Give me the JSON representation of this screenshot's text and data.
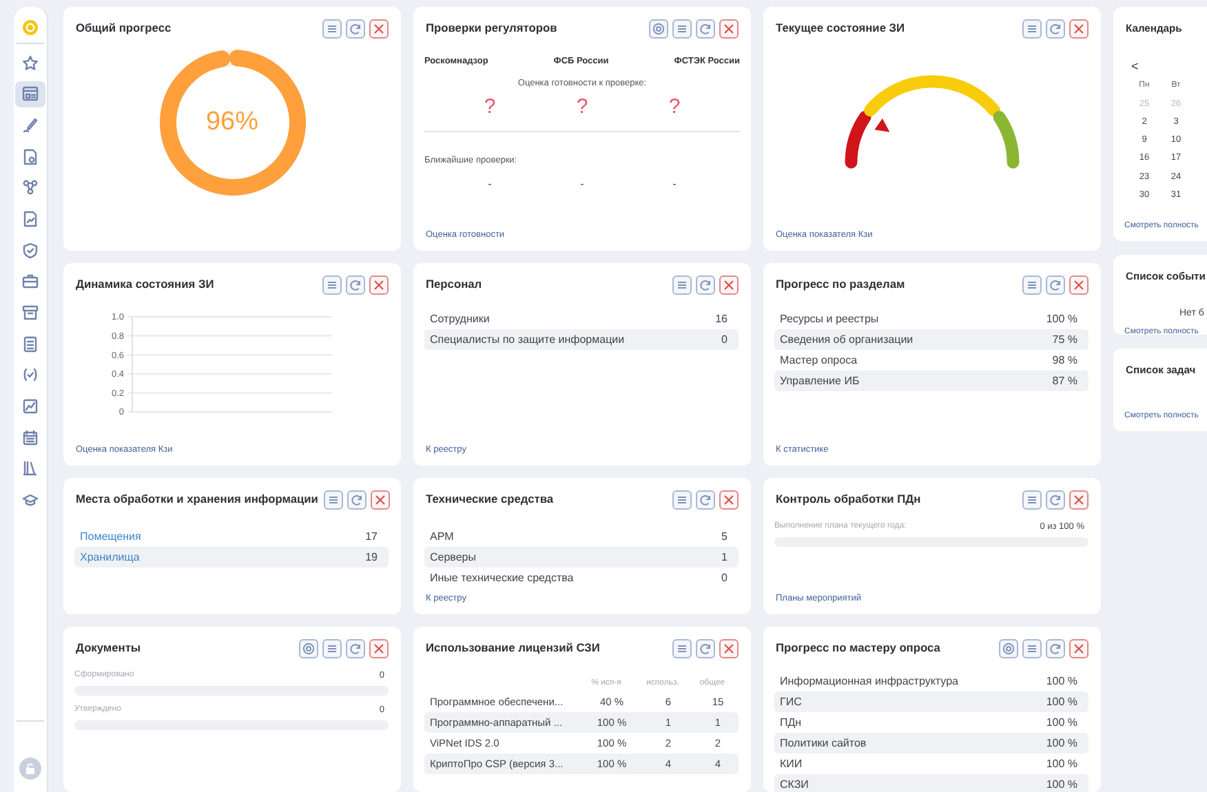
{
  "sidebar": {
    "items": [
      {
        "selected": false
      },
      {
        "selected": true
      },
      {
        "selected": false
      },
      {
        "selected": false
      },
      {
        "selected": false
      },
      {
        "selected": false
      },
      {
        "selected": false
      },
      {
        "selected": false
      },
      {
        "selected": false
      },
      {
        "selected": false
      },
      {
        "selected": false
      },
      {
        "selected": false
      },
      {
        "selected": false
      },
      {
        "selected": false
      },
      {
        "selected": false
      }
    ]
  },
  "cards": [
    {
      "kind": "donut",
      "title": "Общий прогресс",
      "actions": [
        {
          "kind": "menu"
        },
        {
          "kind": "refresh"
        },
        {
          "kind": "close"
        }
      ],
      "value": "96%",
      "level": 0.96
    },
    {
      "kind": "regulators",
      "title": "Проверки регуляторов",
      "actions": [
        {
          "kind": "settings"
        },
        {
          "kind": "menu"
        },
        {
          "kind": "refresh"
        },
        {
          "kind": "close"
        }
      ],
      "readiness_label": "Оценка готовности к проверке:",
      "next_label": "Ближайшие проверки:",
      "regulators": [
        {
          "name": "Роскомнадзор",
          "readiness": "?",
          "next_check": "-"
        },
        {
          "name": "ФСБ России",
          "readiness": "?",
          "next_check": "-"
        },
        {
          "name": "ФСТЭК России",
          "readiness": "?",
          "next_check": "-"
        }
      ],
      "footer": "Оценка готовности"
    },
    {
      "kind": "gauge",
      "title": "Текущее состояние ЗИ",
      "actions": [
        {
          "kind": "menu"
        },
        {
          "kind": "refresh"
        },
        {
          "kind": "close"
        }
      ],
      "footer": "Оценка показателя Кзи"
    },
    {
      "kind": "axes",
      "title": "Динамика состояния ЗИ",
      "actions": [
        {
          "kind": "menu"
        },
        {
          "kind": "refresh"
        },
        {
          "kind": "close"
        }
      ],
      "y_axis_labels": [
        "1.0",
        "0.8",
        "0.6",
        "0.4",
        "0.2",
        "0"
      ],
      "footer": "Оценка показателя Кзи"
    },
    {
      "kind": "list",
      "title": "Персонал",
      "actions": [
        {
          "kind": "menu"
        },
        {
          "kind": "refresh"
        },
        {
          "kind": "close"
        }
      ],
      "rows": [
        {
          "label": "Сотрудники",
          "value": "16"
        },
        {
          "label": "Специалисты по защите информации",
          "value": "0"
        }
      ],
      "footer": "К реестру"
    },
    {
      "kind": "list",
      "title": "Прогресс по разделам",
      "actions": [
        {
          "kind": "menu"
        },
        {
          "kind": "refresh"
        },
        {
          "kind": "close"
        }
      ],
      "rows": [
        {
          "label": "Ресурсы и реестры",
          "value": "100 %"
        },
        {
          "label": "Сведения об организации",
          "value": "75 %"
        },
        {
          "label": "Мастер опроса",
          "value": "98 %"
        },
        {
          "label": "Управление ИБ",
          "value": "87 %"
        }
      ],
      "footer": "К статистике"
    },
    {
      "kind": "list",
      "title": "Места обработки и хранения информации",
      "actions": [
        {
          "kind": "menu"
        },
        {
          "kind": "refresh"
        },
        {
          "kind": "close"
        }
      ],
      "links": true,
      "rows": [
        {
          "label": "Помещения",
          "value": "17"
        },
        {
          "label": "Хранилища",
          "value": "19"
        }
      ]
    },
    {
      "kind": "list",
      "title": "Технические средства",
      "actions": [
        {
          "kind": "menu"
        },
        {
          "kind": "refresh"
        },
        {
          "kind": "close"
        }
      ],
      "rows": [
        {
          "label": "АРМ",
          "value": "5"
        },
        {
          "label": "Серверы",
          "value": "1"
        },
        {
          "label": "Иные технические средства",
          "value": "0"
        }
      ],
      "footer": "К реестру"
    },
    {
      "kind": "progress",
      "title": "Контроль обработки ПДн",
      "actions": [
        {
          "kind": "menu"
        },
        {
          "kind": "refresh"
        },
        {
          "kind": "close"
        }
      ],
      "bars": [
        {
          "label": "Выполнение плана текущего года:",
          "reading": "0 из 100 %",
          "level": 0
        }
      ],
      "footer": "Планы мероприятий"
    },
    {
      "kind": "progress",
      "title": "Документы",
      "actions": [
        {
          "kind": "settings"
        },
        {
          "kind": "menu"
        },
        {
          "kind": "refresh"
        },
        {
          "kind": "close"
        }
      ],
      "bars": [
        {
          "label": "Сформировано",
          "reading": "0",
          "level": 0
        },
        {
          "label": "Утверждено",
          "reading": "0",
          "level": 0
        }
      ]
    },
    {
      "kind": "table",
      "title": "Использование лицензий СЗИ",
      "actions": [
        {
          "kind": "menu"
        },
        {
          "kind": "refresh"
        },
        {
          "kind": "close"
        }
      ],
      "columns": [
        "% исп-я",
        "использ.",
        "общее"
      ],
      "rows": [
        {
          "name": "Программное обеспечени...",
          "cells": [
            "40 %",
            "6",
            "15"
          ]
        },
        {
          "name": "Программно-аппаратный ...",
          "cells": [
            "100 %",
            "1",
            "1"
          ]
        },
        {
          "name": "ViPNet IDS 2.0",
          "cells": [
            "100 %",
            "2",
            "2"
          ]
        },
        {
          "name": "КриптоПро CSP (версия 3...",
          "cells": [
            "100 %",
            "4",
            "4"
          ]
        }
      ]
    },
    {
      "kind": "list",
      "title": "Прогресс по мастеру опроса",
      "actions": [
        {
          "kind": "settings"
        },
        {
          "kind": "menu"
        },
        {
          "kind": "refresh"
        },
        {
          "kind": "close"
        }
      ],
      "rows": [
        {
          "label": "Информационная инфраструктура",
          "value": "100 %"
        },
        {
          "label": "ГИС",
          "value": "100 %"
        },
        {
          "label": "ПДн",
          "value": "100 %"
        },
        {
          "label": "Политики сайтов",
          "value": "100 %"
        },
        {
          "label": "КИИ",
          "value": "100 %"
        },
        {
          "label": "СКЗИ",
          "value": "100 %"
        }
      ]
    }
  ],
  "side_cards": [
    {
      "kind": "calendar",
      "title": "Календарь",
      "prev": "<",
      "weekdays": [
        "Пн",
        "Вт"
      ],
      "days": [
        {
          "text": "25",
          "other_month": true
        },
        {
          "text": "26",
          "other_month": true
        },
        {
          "text": "2",
          "other_month": false
        },
        {
          "text": "3",
          "other_month": false
        },
        {
          "text": "9",
          "other_month": false
        },
        {
          "text": "10",
          "other_month": false
        },
        {
          "text": "16",
          "other_month": false
        },
        {
          "text": "17",
          "other_month": false
        },
        {
          "text": "23",
          "other_month": false
        },
        {
          "text": "24",
          "other_month": false
        },
        {
          "text": "30",
          "other_month": false
        },
        {
          "text": "31",
          "other_month": false
        }
      ],
      "footer": "Смотреть полность"
    },
    {
      "kind": "events",
      "title": "Список событи",
      "empty": "Нет б",
      "footer": "Смотреть полность"
    },
    {
      "kind": "tasks",
      "title": "Список задач",
      "footer": "Смотреть полность"
    }
  ]
}
